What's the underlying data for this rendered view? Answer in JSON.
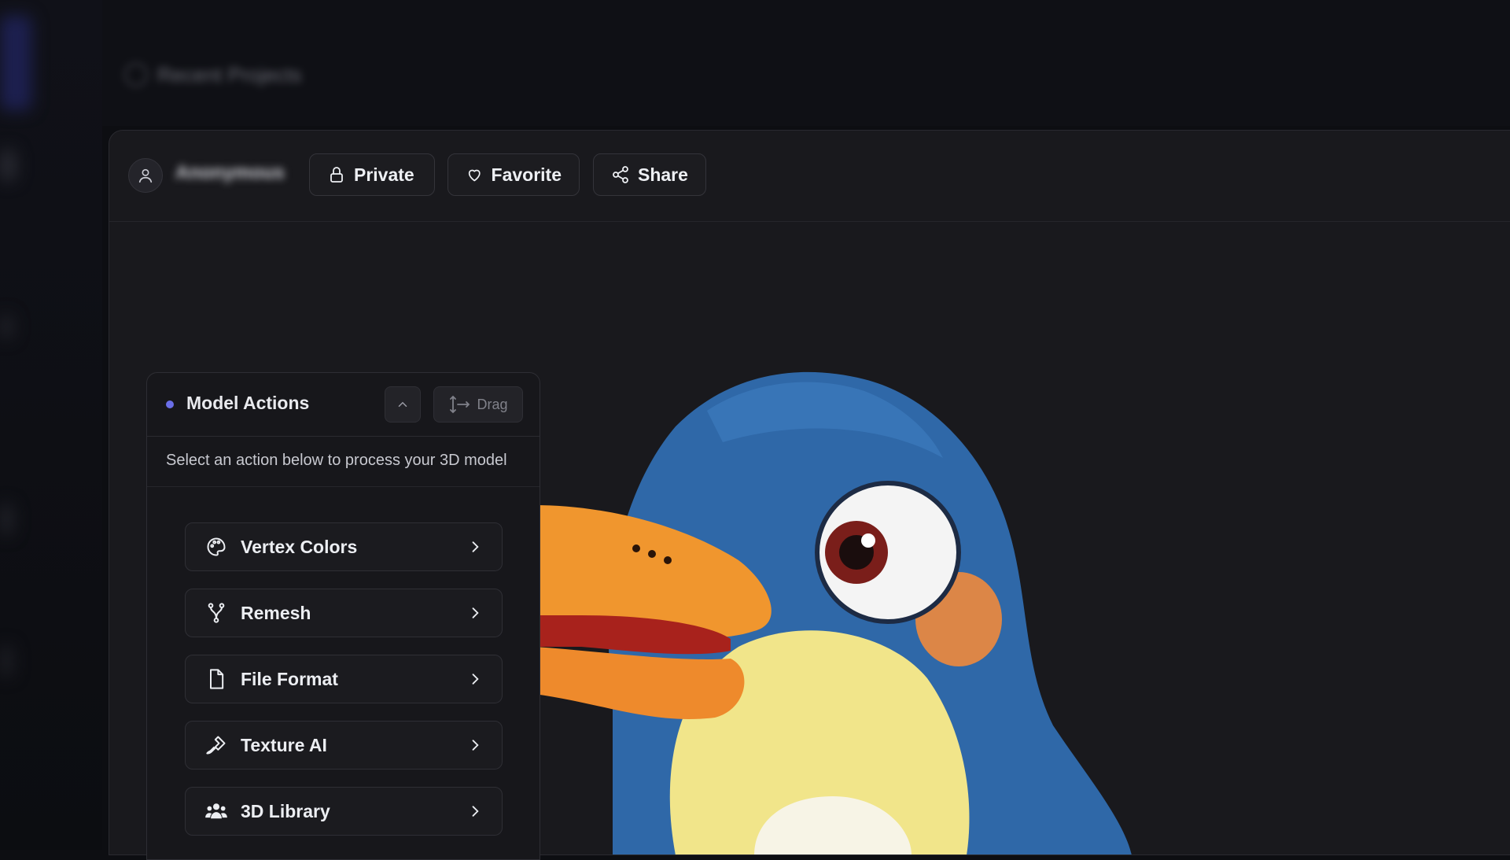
{
  "header": {
    "recent_label": "Recent Projects"
  },
  "card": {
    "username": "Anonymous",
    "buttons": {
      "private": "Private",
      "favorite": "Favorite",
      "share": "Share"
    }
  },
  "panel": {
    "title": "Model Actions",
    "drag_label": "Drag",
    "description": "Select an action below to process your 3D model",
    "actions": [
      {
        "label": "Vertex Colors",
        "icon": "palette-icon"
      },
      {
        "label": "Remesh",
        "icon": "fork-icon"
      },
      {
        "label": "File Format",
        "icon": "file-icon"
      },
      {
        "label": "Texture AI",
        "icon": "brush-icon"
      },
      {
        "label": "3D Library",
        "icon": "users-icon"
      }
    ]
  },
  "colors": {
    "accent_dot": "#6a6ee8",
    "penguin_blue": "#2f68a8",
    "penguin_beak": "#f0962e"
  }
}
